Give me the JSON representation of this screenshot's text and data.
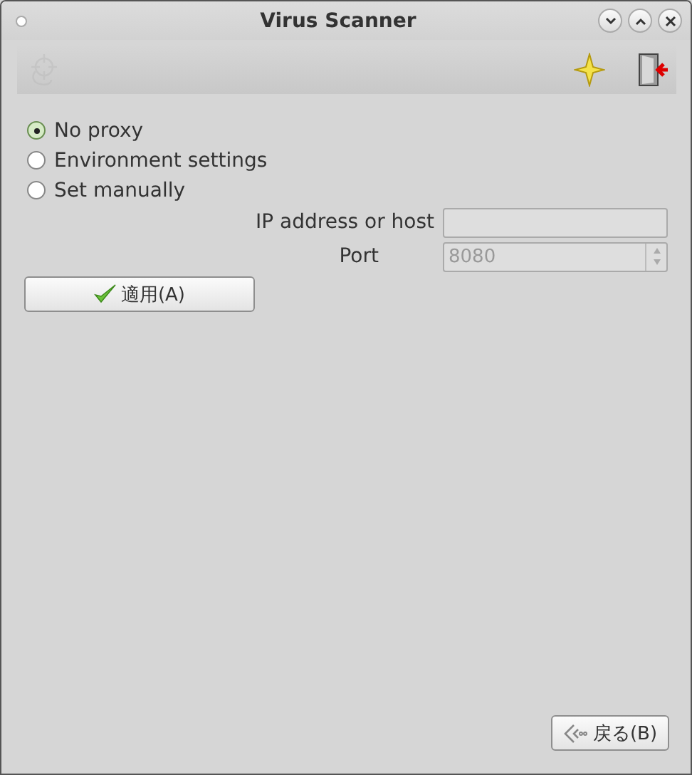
{
  "window": {
    "title": "Virus Scanner"
  },
  "toolbar": [
    {
      "kind": "target",
      "disabled": true
    },
    {
      "kind": "star",
      "disabled": false
    },
    {
      "kind": "exit",
      "disabled": false
    }
  ],
  "proxy_options": [
    {
      "label": "No proxy",
      "selected": true
    },
    {
      "label": "Environment settings",
      "selected": false
    },
    {
      "label": "Set manually",
      "selected": false
    }
  ],
  "fields": [
    {
      "label": "IP address or host",
      "kind": "text",
      "disabled": true
    },
    {
      "label": "Port",
      "kind": "spin",
      "value": "8080",
      "disabled": true
    }
  ],
  "apply_button": {
    "label": "適用(A)"
  },
  "back_button": {
    "label": "戻る(B)"
  }
}
